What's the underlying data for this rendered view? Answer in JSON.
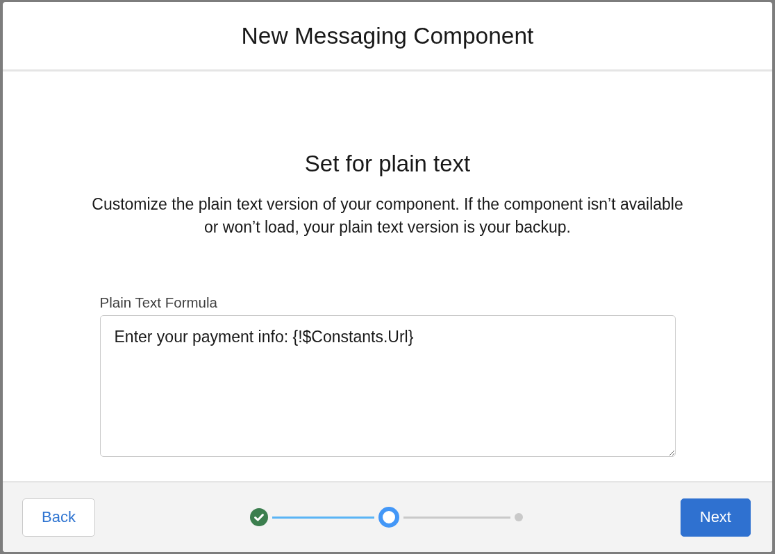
{
  "modal": {
    "title": "New Messaging Component",
    "heading": "Set for plain text",
    "description": "Customize the plain text version of your component. If the component isn’t available or won’t load, your plain text version is your backup.",
    "formula_field": {
      "label": "Plain Text Formula",
      "value": "Enter your payment info: {!$Constants.Url}"
    },
    "footer": {
      "back_button": "Back",
      "progress": {
        "steps": [
          {
            "completed": true,
            "selected": false
          },
          {
            "completed": false,
            "selected": true
          },
          {
            "completed": false,
            "selected": false
          }
        ]
      },
      "next_button": "Next"
    }
  }
}
